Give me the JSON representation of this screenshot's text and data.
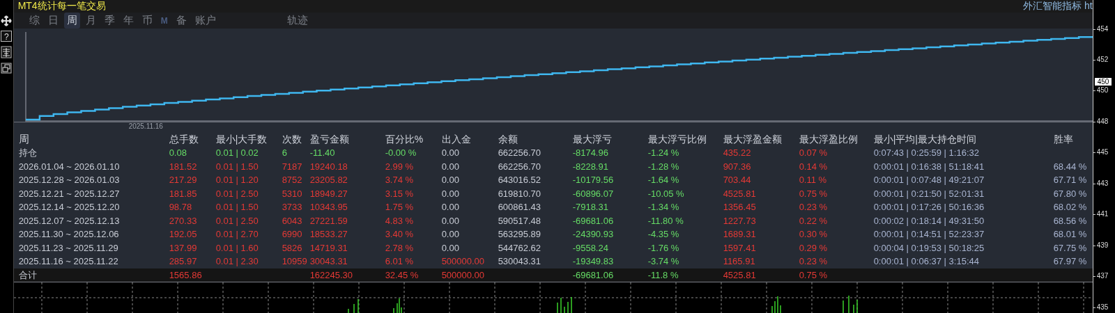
{
  "window": {
    "title": "MT4统计每一笔交易",
    "right_text": "外汇智能指标 ht"
  },
  "side_toolbar": {
    "help": "?"
  },
  "tabs": [
    {
      "label": "综",
      "kind": "text",
      "selected": false
    },
    {
      "label": "日",
      "kind": "text",
      "selected": false
    },
    {
      "label": "周",
      "kind": "text",
      "selected": true
    },
    {
      "label": "月",
      "kind": "text",
      "selected": false
    },
    {
      "label": "季",
      "kind": "text",
      "selected": false
    },
    {
      "label": "年",
      "kind": "text",
      "selected": false
    },
    {
      "label": "币",
      "kind": "text",
      "selected": false
    },
    {
      "label": "M",
      "kind": "mark",
      "selected": false
    },
    {
      "label": "备",
      "kind": "text",
      "selected": false
    },
    {
      "label": "账户",
      "kind": "text",
      "selected": false
    },
    {
      "label": "轨迹",
      "kind": "far",
      "selected": false
    }
  ],
  "equity_chart": {
    "x_label": "2025.11.16"
  },
  "table": {
    "columns": [
      "周",
      "总手数",
      "最小|大手数",
      "次数",
      "盈亏金额",
      "百分比%",
      "出入金",
      "余额",
      "最大浮亏",
      "最大浮亏比例",
      "最大浮盈金额",
      "最大浮盈比例",
      "最小|平均|最大持仓时间",
      "胜率"
    ],
    "rows": [
      {
        "cells": [
          {
            "text": "持仓",
            "color": "#c9cdd6"
          },
          {
            "text": "0.08",
            "color": "#66dd66"
          },
          {
            "text": "0.01 | 0.02",
            "color": "#66dd66"
          },
          {
            "text": "6",
            "color": "#66dd66"
          },
          {
            "text": "-11.40",
            "color": "#66dd66"
          },
          {
            "text": "-0.00 %",
            "color": "#66dd66"
          },
          {
            "text": "0.00",
            "color": "#c9cdd6"
          },
          {
            "text": "662256.70",
            "color": "#c9cdd6"
          },
          {
            "text": "-8174.96",
            "color": "#66dd66"
          },
          {
            "text": "-1.24 %",
            "color": "#66dd66"
          },
          {
            "text": "435.22",
            "color": "#e53935"
          },
          {
            "text": "0.07 %",
            "color": "#e53935"
          },
          {
            "text": "0:07:43 | 0:25:59 | 1:16:32",
            "color": "#a9b5d1"
          },
          null
        ]
      },
      {
        "cells": [
          {
            "text": "2026.01.04 ~ 2026.01.10",
            "color": "#c9cdd6"
          },
          {
            "text": "181.52",
            "color": "#e53935"
          },
          {
            "text": "0.01 | 1.50",
            "color": "#e53935"
          },
          {
            "text": "7187",
            "color": "#e53935"
          },
          {
            "text": "19240.18",
            "color": "#e53935"
          },
          {
            "text": "2.99 %",
            "color": "#e53935"
          },
          {
            "text": "0.00",
            "color": "#c9cdd6"
          },
          {
            "text": "662256.70",
            "color": "#c9cdd6"
          },
          {
            "text": "-8228.91",
            "color": "#66dd66"
          },
          {
            "text": "-1.28 %",
            "color": "#66dd66"
          },
          {
            "text": "907.36",
            "color": "#e53935"
          },
          {
            "text": "0.14 %",
            "color": "#e53935"
          },
          {
            "text": "0:00:01 | 0:16:38 | 51:18:41",
            "color": "#a9b5d1"
          },
          {
            "text": "68.44 %",
            "color": "#a9b5d1"
          }
        ]
      },
      {
        "cells": [
          {
            "text": "2025.12.28 ~ 2026.01.03",
            "color": "#c9cdd6"
          },
          {
            "text": "217.29",
            "color": "#e53935"
          },
          {
            "text": "0.01 | 1.20",
            "color": "#e53935"
          },
          {
            "text": "8752",
            "color": "#e53935"
          },
          {
            "text": "23205.82",
            "color": "#e53935"
          },
          {
            "text": "3.74 %",
            "color": "#e53935"
          },
          {
            "text": "0.00",
            "color": "#c9cdd6"
          },
          {
            "text": "643016.52",
            "color": "#c9cdd6"
          },
          {
            "text": "-10179.56",
            "color": "#66dd66"
          },
          {
            "text": "-1.64 %",
            "color": "#66dd66"
          },
          {
            "text": "703.44",
            "color": "#e53935"
          },
          {
            "text": "0.11 %",
            "color": "#e53935"
          },
          {
            "text": "0:00:01 | 0:07:48 | 49:21:07",
            "color": "#a9b5d1"
          },
          {
            "text": "67.71 %",
            "color": "#a9b5d1"
          }
        ]
      },
      {
        "cells": [
          {
            "text": "2025.12.21 ~ 2025.12.27",
            "color": "#c9cdd6"
          },
          {
            "text": "181.85",
            "color": "#e53935"
          },
          {
            "text": "0.01 | 2.50",
            "color": "#e53935"
          },
          {
            "text": "5310",
            "color": "#e53935"
          },
          {
            "text": "18949.27",
            "color": "#e53935"
          },
          {
            "text": "3.15 %",
            "color": "#e53935"
          },
          {
            "text": "0.00",
            "color": "#c9cdd6"
          },
          {
            "text": "619810.70",
            "color": "#c9cdd6"
          },
          {
            "text": "-60896.07",
            "color": "#66dd66"
          },
          {
            "text": "-10.05 %",
            "color": "#66dd66"
          },
          {
            "text": "4525.81",
            "color": "#e53935"
          },
          {
            "text": "0.75 %",
            "color": "#e53935"
          },
          {
            "text": "0:00:01 | 0:21:50 | 52:01:31",
            "color": "#a9b5d1"
          },
          {
            "text": "67.80 %",
            "color": "#a9b5d1"
          }
        ]
      },
      {
        "cells": [
          {
            "text": "2025.12.14 ~ 2025.12.20",
            "color": "#c9cdd6"
          },
          {
            "text": "98.78",
            "color": "#e53935"
          },
          {
            "text": "0.01 | 1.50",
            "color": "#e53935"
          },
          {
            "text": "3733",
            "color": "#e53935"
          },
          {
            "text": "10343.95",
            "color": "#e53935"
          },
          {
            "text": "1.75 %",
            "color": "#e53935"
          },
          {
            "text": "0.00",
            "color": "#c9cdd6"
          },
          {
            "text": "600861.43",
            "color": "#c9cdd6"
          },
          {
            "text": "-7918.31",
            "color": "#66dd66"
          },
          {
            "text": "-1.34 %",
            "color": "#66dd66"
          },
          {
            "text": "1356.45",
            "color": "#e53935"
          },
          {
            "text": "0.23 %",
            "color": "#e53935"
          },
          {
            "text": "0:00:01 | 0:17:26 | 50:16:36",
            "color": "#a9b5d1"
          },
          {
            "text": "68.02 %",
            "color": "#a9b5d1"
          }
        ]
      },
      {
        "cells": [
          {
            "text": "2025.12.07 ~ 2025.12.13",
            "color": "#c9cdd6"
          },
          {
            "text": "270.33",
            "color": "#e53935"
          },
          {
            "text": "0.01 | 2.50",
            "color": "#e53935"
          },
          {
            "text": "6043",
            "color": "#e53935"
          },
          {
            "text": "27221.59",
            "color": "#e53935"
          },
          {
            "text": "4.83 %",
            "color": "#e53935"
          },
          {
            "text": "0.00",
            "color": "#c9cdd6"
          },
          {
            "text": "590517.48",
            "color": "#c9cdd6"
          },
          {
            "text": "-69681.06",
            "color": "#66dd66"
          },
          {
            "text": "-11.80 %",
            "color": "#66dd66"
          },
          {
            "text": "1227.73",
            "color": "#e53935"
          },
          {
            "text": "0.22 %",
            "color": "#e53935"
          },
          {
            "text": "0:00:02 | 0:18:14 | 49:31:50",
            "color": "#a9b5d1"
          },
          {
            "text": "68.56 %",
            "color": "#a9b5d1"
          }
        ]
      },
      {
        "cells": [
          {
            "text": "2025.11.30 ~ 2025.12.06",
            "color": "#c9cdd6"
          },
          {
            "text": "192.05",
            "color": "#e53935"
          },
          {
            "text": "0.01 | 2.70",
            "color": "#e53935"
          },
          {
            "text": "6990",
            "color": "#e53935"
          },
          {
            "text": "18533.27",
            "color": "#e53935"
          },
          {
            "text": "3.40 %",
            "color": "#e53935"
          },
          {
            "text": "0.00",
            "color": "#c9cdd6"
          },
          {
            "text": "563295.89",
            "color": "#c9cdd6"
          },
          {
            "text": "-24390.93",
            "color": "#66dd66"
          },
          {
            "text": "-4.35 %",
            "color": "#66dd66"
          },
          {
            "text": "1689.31",
            "color": "#e53935"
          },
          {
            "text": "0.30 %",
            "color": "#e53935"
          },
          {
            "text": "0:00:01 | 0:14:51 | 52:23:37",
            "color": "#a9b5d1"
          },
          {
            "text": "68.01 %",
            "color": "#a9b5d1"
          }
        ]
      },
      {
        "cells": [
          {
            "text": "2025.11.23 ~ 2025.11.29",
            "color": "#c9cdd6"
          },
          {
            "text": "137.99",
            "color": "#e53935"
          },
          {
            "text": "0.01 | 1.60",
            "color": "#e53935"
          },
          {
            "text": "5826",
            "color": "#e53935"
          },
          {
            "text": "14719.31",
            "color": "#e53935"
          },
          {
            "text": "2.78 %",
            "color": "#e53935"
          },
          {
            "text": "0.00",
            "color": "#c9cdd6"
          },
          {
            "text": "544762.62",
            "color": "#c9cdd6"
          },
          {
            "text": "-9558.24",
            "color": "#66dd66"
          },
          {
            "text": "-1.76 %",
            "color": "#66dd66"
          },
          {
            "text": "1597.41",
            "color": "#e53935"
          },
          {
            "text": "0.29 %",
            "color": "#e53935"
          },
          {
            "text": "0:00:04 | 0:19:53 | 50:18:25",
            "color": "#a9b5d1"
          },
          {
            "text": "67.75 %",
            "color": "#a9b5d1"
          }
        ]
      },
      {
        "cells": [
          {
            "text": "2025.11.16 ~ 2025.11.22",
            "color": "#c9cdd6"
          },
          {
            "text": "285.97",
            "color": "#e53935"
          },
          {
            "text": "0.01 | 2.30",
            "color": "#e53935"
          },
          {
            "text": "10959",
            "color": "#e53935"
          },
          {
            "text": "30043.31",
            "color": "#e53935"
          },
          {
            "text": "6.01 %",
            "color": "#e53935"
          },
          {
            "text": "500000.00",
            "color": "#e53935"
          },
          {
            "text": "530043.31",
            "color": "#c9cdd6"
          },
          {
            "text": "-19349.83",
            "color": "#66dd66"
          },
          {
            "text": "-3.74 %",
            "color": "#66dd66"
          },
          {
            "text": "1165.91",
            "color": "#e53935"
          },
          {
            "text": "0.23 %",
            "color": "#e53935"
          },
          {
            "text": "0:00:01 | 0:06:37 | 3:15:44",
            "color": "#a9b5d1"
          },
          {
            "text": "67.97 %",
            "color": "#a9b5d1"
          }
        ]
      }
    ],
    "total": {
      "cells": [
        {
          "text": "合计",
          "color": "#c9cdd6"
        },
        {
          "text": "1565.86",
          "color": "#e53935"
        },
        null,
        null,
        {
          "text": "162245.30",
          "color": "#e53935"
        },
        {
          "text": "32.45 %",
          "color": "#e53935"
        },
        {
          "text": "500000.00",
          "color": "#e53935"
        },
        null,
        {
          "text": "-69681.06",
          "color": "#66dd66"
        },
        {
          "text": "-11.8 %",
          "color": "#66dd66"
        },
        {
          "text": "4525.81",
          "color": "#e53935"
        },
        {
          "text": "0.75 %",
          "color": "#e53935"
        },
        null,
        null
      ]
    }
  },
  "price_axis": {
    "labels": [
      "454",
      "452",
      "450",
      "448",
      "445",
      "443",
      "441",
      "439",
      "437",
      "435"
    ],
    "price_tag": "450"
  }
}
